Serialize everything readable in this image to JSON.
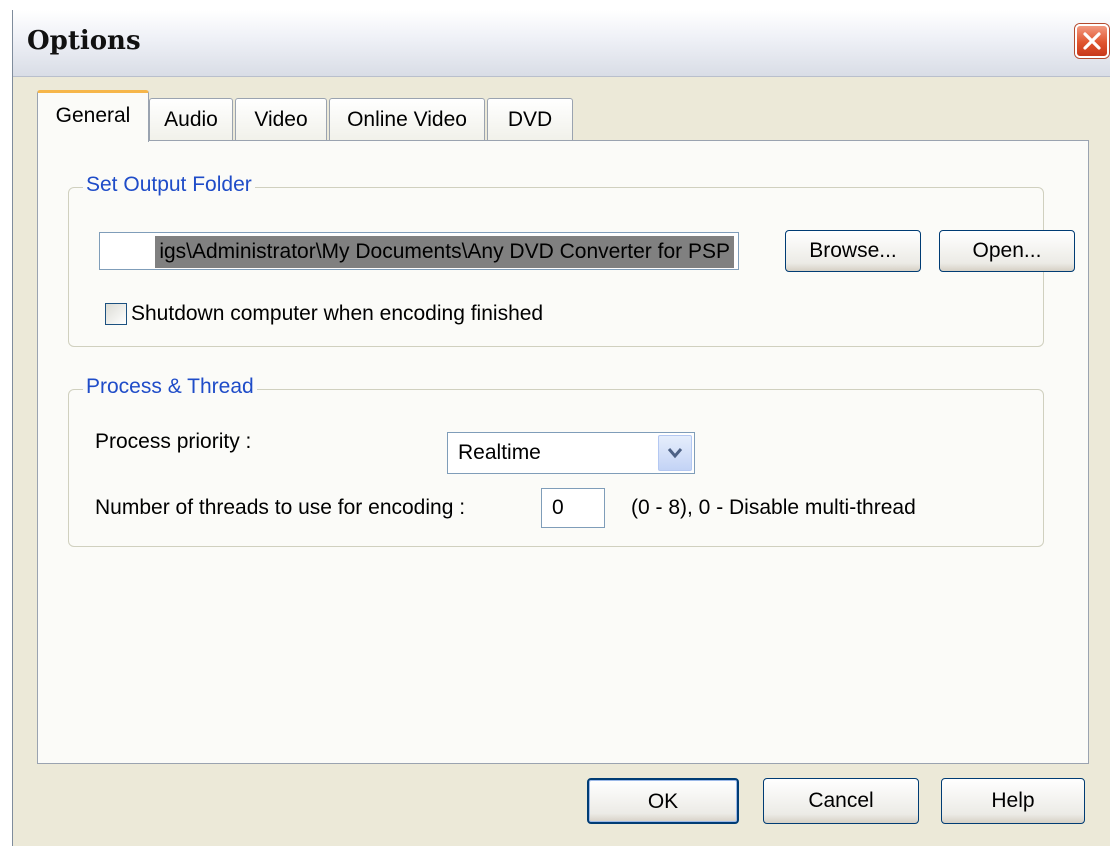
{
  "window": {
    "title": "Options"
  },
  "tabs": [
    {
      "label": "General",
      "active": true
    },
    {
      "label": "Audio"
    },
    {
      "label": "Video"
    },
    {
      "label": "Online Video"
    },
    {
      "label": "DVD"
    }
  ],
  "output_folder": {
    "legend": "Set Output Folder",
    "path": "igs\\Administrator\\My Documents\\Any DVD Converter for PSP",
    "browse_label": "Browse...",
    "open_label": "Open...",
    "shutdown_label": "Shutdown computer when encoding finished",
    "shutdown_checked": false
  },
  "process": {
    "legend": "Process & Thread",
    "priority_label": "Process priority :",
    "priority_value": "Realtime",
    "threads_label": "Number of threads to use for encoding :",
    "threads_value": "0",
    "threads_hint": "(0 - 8), 0 - Disable multi-thread"
  },
  "footer": {
    "ok_label": "OK",
    "cancel_label": "Cancel",
    "help_label": "Help"
  },
  "colors": {
    "accent_tab": "#f6b64a",
    "group_legend": "#1f4cc8",
    "close_button": "#e0552f",
    "dialog_bg": "#ece9d8"
  },
  "icons": {
    "close": "close-x-icon",
    "dropdown": "chevron-down-icon"
  }
}
